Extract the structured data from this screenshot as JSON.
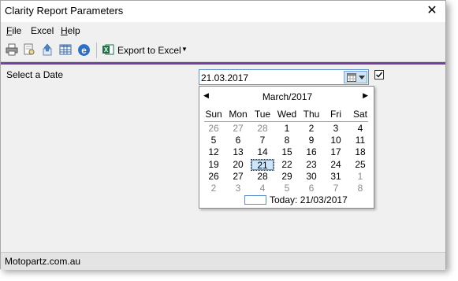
{
  "window": {
    "title": "Clarity Report Parameters"
  },
  "menu": [
    {
      "label_prefix": "",
      "underline": "F",
      "rest": "ile"
    },
    {
      "label_prefix": "Excel",
      "underline": "",
      "rest": ""
    },
    {
      "label_prefix": "",
      "underline": "H",
      "rest": "elp"
    }
  ],
  "toolbar": {
    "icons": [
      "printer-icon",
      "print-preview-icon",
      "export-icon",
      "table-icon",
      "email-icon"
    ],
    "export_label": "Export to Excel",
    "export_dropdown_glyph": "▼"
  },
  "accent": {
    "top": "#b0208a",
    "bottom": "#3a5bbf",
    "selection": "#cde5fb"
  },
  "form": {
    "prompt": "Select a Date",
    "date_value": "21.03.2017",
    "checkbox_checked": true
  },
  "calendar": {
    "prev_glyph": "◀",
    "next_glyph": "▶",
    "month": "March/2017",
    "weekdays": [
      "Sun",
      "Mon",
      "Tue",
      "Wed",
      "Thu",
      "Fri",
      "Sat"
    ],
    "weeks": [
      [
        "26",
        "27",
        "28",
        "1",
        "2",
        "3",
        "4"
      ],
      [
        "5",
        "6",
        "7",
        "8",
        "9",
        "10",
        "11"
      ],
      [
        "12",
        "13",
        "14",
        "15",
        "16",
        "17",
        "18"
      ],
      [
        "19",
        "20",
        "21",
        "22",
        "23",
        "24",
        "25"
      ],
      [
        "26",
        "27",
        "28",
        "29",
        "30",
        "31",
        "1"
      ],
      [
        "2",
        "3",
        "4",
        "5",
        "6",
        "7",
        "8"
      ]
    ],
    "selected_day": "21",
    "today_label": "Today: 21/03/2017"
  },
  "status": {
    "text": "Motopartz.com.au"
  }
}
